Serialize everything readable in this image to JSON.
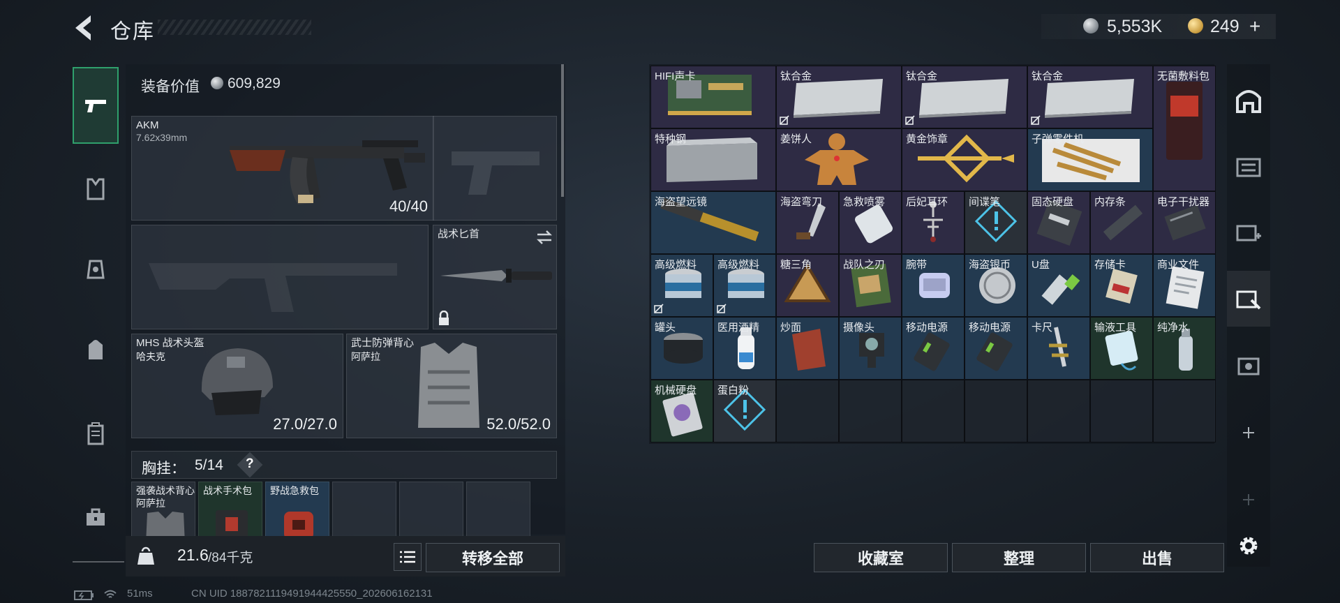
{
  "header": {
    "title": "仓库",
    "currency_1": "5,553K",
    "currency_2": "249",
    "plus": "+"
  },
  "left_tabs": [
    "weapon",
    "armor-vest",
    "backpack-outfit",
    "backpack",
    "case",
    "toolbox"
  ],
  "equipment": {
    "value_label": "装备价值",
    "value": "609,829",
    "primary_weapon": {
      "name": "AKM",
      "caliber": "7.62x39mm",
      "ammo": "40/40"
    },
    "melee": {
      "name": "战术匕首"
    },
    "helmet": {
      "name": "MHS 战术头盔",
      "maker": "哈夫克",
      "durability": "27.0/27.0"
    },
    "armor": {
      "name": "武士防弹背心",
      "maker": "阿萨拉",
      "durability": "52.0/52.0"
    },
    "rig": {
      "label": "胸挂：",
      "count": "5/14",
      "help": "?"
    },
    "rig_slots": [
      {
        "name": "强袭战术背心",
        "sub": "阿萨拉"
      },
      {
        "name": "战术手术包",
        "sub": ""
      },
      {
        "name": "野战急救包",
        "sub": ""
      },
      {
        "name": "",
        "sub": ""
      },
      {
        "name": "",
        "sub": ""
      },
      {
        "name": "",
        "sub": ""
      }
    ]
  },
  "bottom": {
    "weight": "21.6",
    "weight_max": "/84千克",
    "transfer_all": "转移全部"
  },
  "inventory": [
    {
      "name": "HIFI声卡",
      "rarity": "purple",
      "icon": "circuit-card"
    },
    {
      "name": "钛合金",
      "rarity": "purple",
      "icon": "metal-plate",
      "bound": true
    },
    {
      "name": "钛合金",
      "rarity": "purple",
      "icon": "metal-plate",
      "bound": true
    },
    {
      "name": "钛合金",
      "rarity": "purple",
      "icon": "metal-plate",
      "bound": true
    },
    {
      "name": "无菌敷料包",
      "rarity": "purple",
      "icon": "dressing-pack"
    },
    {
      "name": "特种钢",
      "rarity": "purple",
      "icon": "steel-block"
    },
    {
      "name": "姜饼人",
      "rarity": "purple",
      "icon": "gingerbread"
    },
    {
      "name": "黄金饰章",
      "rarity": "purple",
      "icon": "gold-emblem"
    },
    {
      "name": "子弹零件机",
      "rarity": "blue",
      "icon": "bullet-kit"
    },
    {
      "name": "海盗望远镜",
      "rarity": "blue",
      "icon": "spyglass"
    },
    {
      "name": "海盗弯刀",
      "rarity": "purple",
      "icon": "knife"
    },
    {
      "name": "急救喷雾",
      "rarity": "purple",
      "icon": "spray-can"
    },
    {
      "name": "后妃耳环",
      "rarity": "purple",
      "icon": "earring"
    },
    {
      "name": "间谍笔",
      "rarity": "dark",
      "icon": "unknown-item"
    },
    {
      "name": "固态硬盘",
      "rarity": "purple",
      "icon": "ssd"
    },
    {
      "name": "内存条",
      "rarity": "purple",
      "icon": "ram-stick"
    },
    {
      "name": "电子干扰器",
      "rarity": "purple",
      "icon": "jammer"
    },
    {
      "name": "高级燃料",
      "rarity": "blue",
      "icon": "fuel-can",
      "bound": true
    },
    {
      "name": "高级燃料",
      "rarity": "blue",
      "icon": "fuel-can",
      "bound": true
    },
    {
      "name": "糖三角",
      "rarity": "purple",
      "icon": "triangle-bun"
    },
    {
      "name": "战队之刃",
      "rarity": "purple",
      "icon": "magazine"
    },
    {
      "name": "腕带",
      "rarity": "blue",
      "icon": "wristband"
    },
    {
      "name": "海盗银币",
      "rarity": "blue",
      "icon": "silver-coin"
    },
    {
      "name": "U盘",
      "rarity": "blue",
      "icon": "usb-drive"
    },
    {
      "name": "存储卡",
      "rarity": "blue",
      "icon": "memory-card"
    },
    {
      "name": "商业文件",
      "rarity": "blue",
      "icon": "document"
    },
    {
      "name": "罐头",
      "rarity": "blue",
      "icon": "canned-food"
    },
    {
      "name": "医用酒精",
      "rarity": "blue",
      "icon": "alcohol-bottle"
    },
    {
      "name": "炒面",
      "rarity": "blue",
      "icon": "noodle-bag"
    },
    {
      "name": "摄像头",
      "rarity": "blue",
      "icon": "camera"
    },
    {
      "name": "移动电源",
      "rarity": "blue",
      "icon": "power-bank"
    },
    {
      "name": "移动电源",
      "rarity": "blue",
      "icon": "power-bank"
    },
    {
      "name": "卡尺",
      "rarity": "blue",
      "icon": "caliper"
    },
    {
      "name": "输液工具",
      "rarity": "green",
      "icon": "iv-bag"
    },
    {
      "name": "纯净水",
      "rarity": "green",
      "icon": "water-bottle"
    },
    {
      "name": "机械硬盘",
      "rarity": "green",
      "icon": "hdd"
    },
    {
      "name": "蛋白粉",
      "rarity": "dark",
      "icon": "unknown-item"
    }
  ],
  "actions": {
    "collection": "收藏室",
    "sort": "整理",
    "sell": "出售"
  },
  "status": {
    "ping": "51ms",
    "uid": "CN UID 1887821119491944425550_202606162131"
  }
}
